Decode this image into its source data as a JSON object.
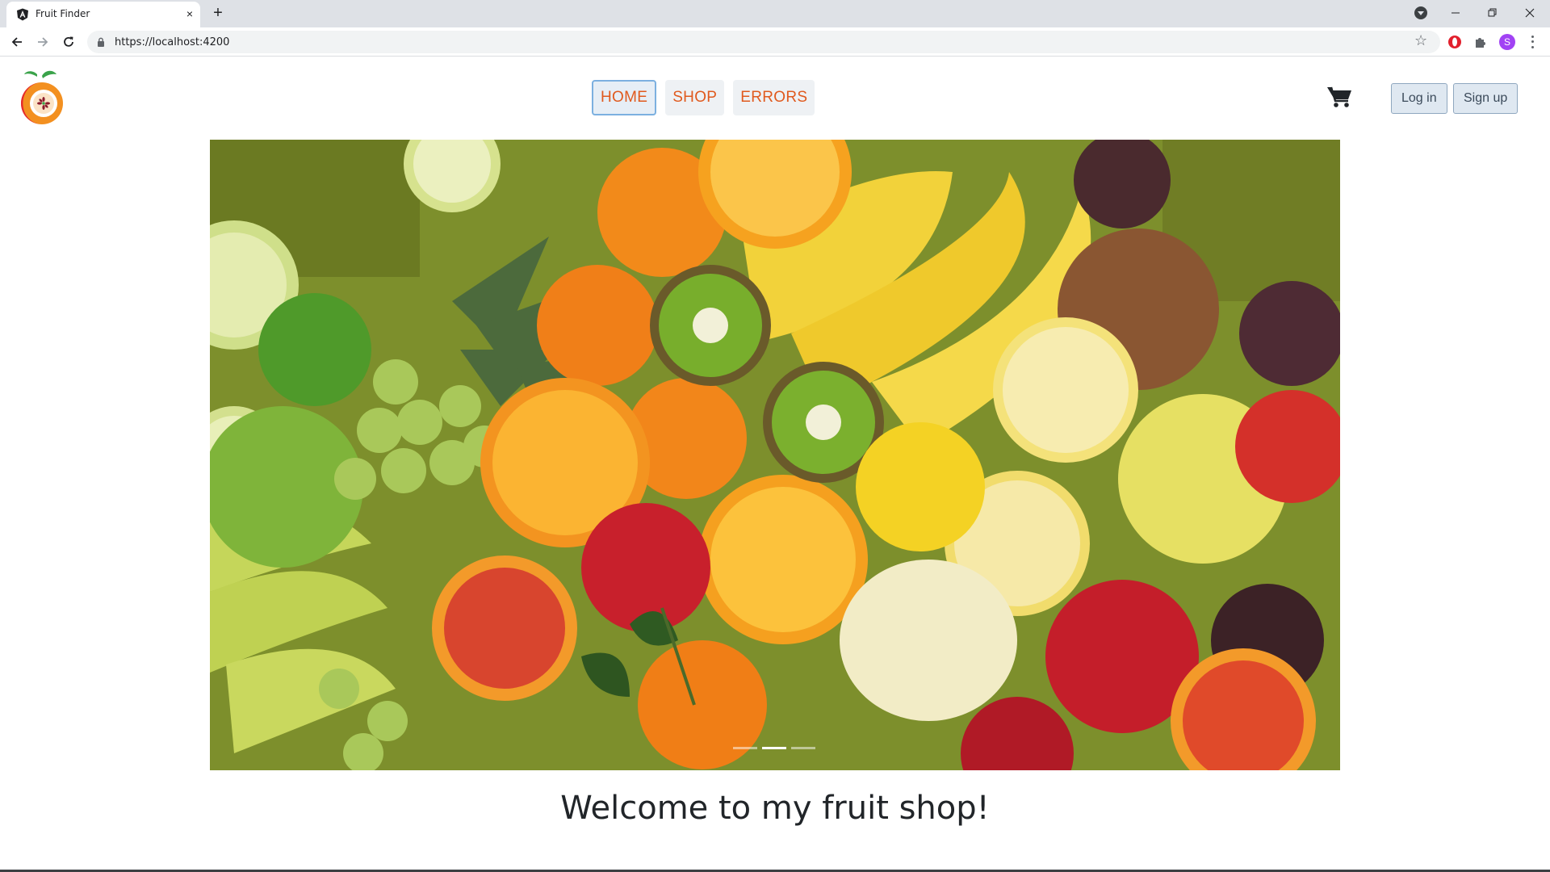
{
  "browser": {
    "tab_title": "Fruit Finder",
    "tab_close": "×",
    "new_tab": "+",
    "url": "https://localhost:4200",
    "profile_initial": "S"
  },
  "nav": {
    "links": [
      "HOME",
      "SHOP",
      "ERRORS"
    ],
    "active": "HOME"
  },
  "auth": {
    "login_label": "Log in",
    "signup_label": "Sign up"
  },
  "carousel": {
    "slide_count": 3,
    "active_index": 1
  },
  "main": {
    "welcome_heading": "Welcome to my fruit shop!"
  },
  "colors": {
    "accent": "#e05a1e",
    "active_border": "#7cb0e0",
    "heading": "#212529",
    "avatar": "#a142f4"
  },
  "icons": [
    "angular-favicon",
    "back-icon",
    "forward-icon",
    "reload-icon",
    "lock-icon",
    "star-icon",
    "opera-icon",
    "puzzle-icon",
    "fruit-logo",
    "cart-icon"
  ]
}
